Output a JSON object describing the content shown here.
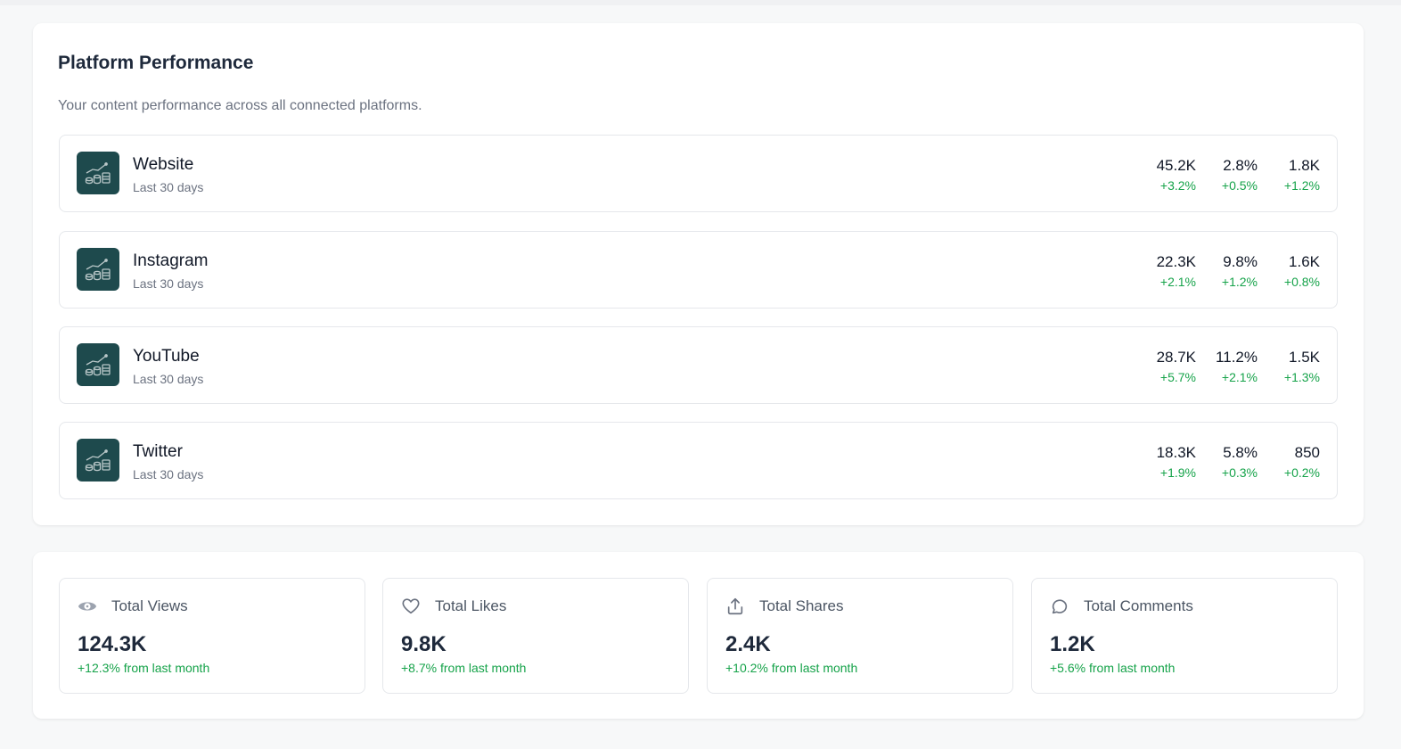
{
  "performance": {
    "title": "Platform Performance",
    "subtitle": "Your content performance across all connected platforms.",
    "platforms": [
      {
        "name": "Website",
        "period": "Last 30 days",
        "metrics": [
          {
            "value": "45.2K",
            "change": "+3.2%"
          },
          {
            "value": "2.8%",
            "change": "+0.5%"
          },
          {
            "value": "1.8K",
            "change": "+1.2%"
          }
        ]
      },
      {
        "name": "Instagram",
        "period": "Last 30 days",
        "metrics": [
          {
            "value": "22.3K",
            "change": "+2.1%"
          },
          {
            "value": "9.8%",
            "change": "+1.2%"
          },
          {
            "value": "1.6K",
            "change": "+0.8%"
          }
        ]
      },
      {
        "name": "YouTube",
        "period": "Last 30 days",
        "metrics": [
          {
            "value": "28.7K",
            "change": "+5.7%"
          },
          {
            "value": "11.2%",
            "change": "+2.1%"
          },
          {
            "value": "1.5K",
            "change": "+1.3%"
          }
        ]
      },
      {
        "name": "Twitter",
        "period": "Last 30 days",
        "metrics": [
          {
            "value": "18.3K",
            "change": "+1.9%"
          },
          {
            "value": "5.8%",
            "change": "+0.3%"
          },
          {
            "value": "850",
            "change": "+0.2%"
          }
        ]
      }
    ]
  },
  "totals": [
    {
      "icon": "eye-icon",
      "label": "Total Views",
      "value": "124.3K",
      "change": "+12.3% from last month"
    },
    {
      "icon": "heart-icon",
      "label": "Total Likes",
      "value": "9.8K",
      "change": "+8.7% from last month"
    },
    {
      "icon": "share-icon",
      "label": "Total Shares",
      "value": "2.4K",
      "change": "+10.2% from last month"
    },
    {
      "icon": "comment-icon",
      "label": "Total Comments",
      "value": "1.2K",
      "change": "+5.6% from last month"
    }
  ],
  "colors": {
    "accent_icon_bg": "#1e4a4d",
    "positive": "#16a34a",
    "border": "#e5e7eb"
  }
}
